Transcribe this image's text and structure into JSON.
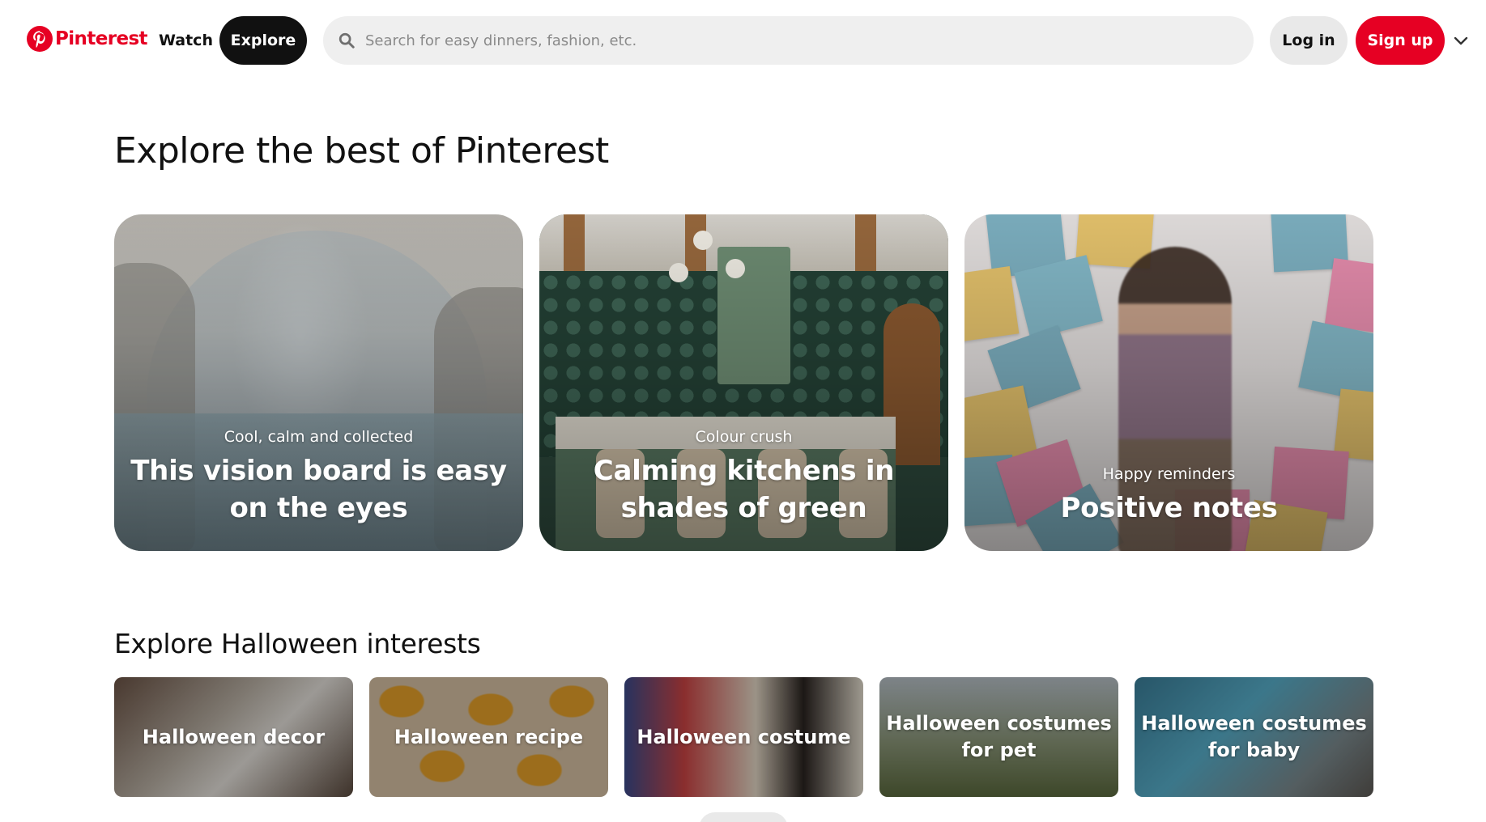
{
  "header": {
    "logo_text": "Pinterest",
    "logo_icon": "pinterest-logo-icon",
    "nav_watch": "Watch",
    "nav_explore": "Explore",
    "search_icon": "search-icon",
    "search_placeholder": "Search for easy dinners, fashion, etc.",
    "login_label": "Log in",
    "signup_label": "Sign up",
    "more_icon": "chevron-down-icon",
    "brand_color": "#e60023"
  },
  "page_title": "Explore the best of Pinterest",
  "featured": [
    {
      "kicker": "Cool, calm and collected",
      "headline": "This vision board is easy on the eyes"
    },
    {
      "kicker": "Colour crush",
      "headline": "Calming kitchens in shades of green"
    },
    {
      "kicker": "Happy reminders",
      "headline": "Positive notes"
    }
  ],
  "interests": {
    "title": "Explore Halloween interests",
    "items": [
      {
        "label": "Halloween decor"
      },
      {
        "label": "Halloween recipe"
      },
      {
        "label": "Halloween costume"
      },
      {
        "label": "Halloween costumes for pet"
      },
      {
        "label": "Halloween costumes for baby"
      }
    ]
  }
}
